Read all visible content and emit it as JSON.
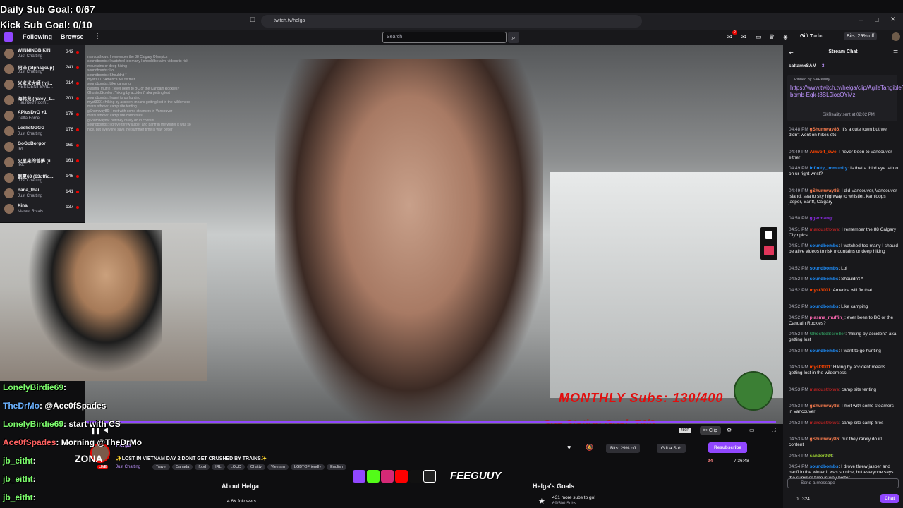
{
  "overlay_goals": {
    "daily": "Daily Sub Goal: 0/67",
    "kick": "Kick Sub Goal: 0/10"
  },
  "browser": {
    "url": "twitch.tv/helga"
  },
  "nav": {
    "following": "Following",
    "browse": "Browse",
    "search_placeholder": "Search",
    "gift_turbo": "Gift Turbo",
    "bits_offer": "Bits: 29% off",
    "notif_count": "9"
  },
  "sidebar": {
    "channels": [
      {
        "name": "WINNINGBIKINI",
        "game": "Just Chatting",
        "viewers": "243"
      },
      {
        "name": "阿泽 (alphagcup)",
        "game": "Just Chatting",
        "viewers": "241"
      },
      {
        "name": "米米米大師 (mi...",
        "game": "RESIDENT EVIL...",
        "viewers": "214"
      },
      {
        "name": "海韩兒 (haley_1...",
        "game": "Haunted Room...",
        "viewers": "201"
      },
      {
        "name": "APlusDvO +1",
        "game": "Delta Force",
        "viewers": "178"
      },
      {
        "name": "LeslieNGGG",
        "game": "Just Chatting",
        "viewers": "176"
      },
      {
        "name": "GoGoBorgor",
        "game": "IRL",
        "viewers": "169"
      },
      {
        "name": "火星來的曾夢 (iii...",
        "game": "IRL",
        "viewers": "161"
      },
      {
        "name": "劉夏63 (63offic...",
        "game": "Just Chatting",
        "viewers": "146"
      },
      {
        "name": "nana_thai",
        "game": "Just Chatting",
        "viewers": "141"
      },
      {
        "name": "Xina",
        "game": "Marvel Rivals",
        "viewers": "137"
      }
    ]
  },
  "video": {
    "monthly_text": "MONTHLY Subs: 130/400",
    "goal_text": "Spa Station Goal: 74/0",
    "progress": 0.995,
    "quality": "480P",
    "clip_label": "Clip"
  },
  "stream_overlay_chat": [
    {
      "user": "LonelyBirdie69",
      "text": ":"
    },
    {
      "user": "TheDrMo",
      "text": ": @Ace0fSpades"
    },
    {
      "user": "LonelyBirdie69",
      "text": ": start with CS"
    },
    {
      "user": "Ace0fSpades",
      "text": ": Morning @TheDrMo"
    },
    {
      "user": "jb_eitht",
      "text": ":"
    },
    {
      "user": "jb_eitht",
      "text": ":"
    },
    {
      "user": "jb_eitht",
      "text": ":"
    }
  ],
  "channel_info": {
    "streamer": "Helga",
    "title": "✨LOST IN VIETNAM DAY 2 DONT GET CRUSHED BY TRAINS✨",
    "category": "Just Chatting",
    "tags": [
      "Travel",
      "Canada",
      "food",
      "IRL",
      "LOUD",
      "Chatty",
      "Vietnam",
      "LGBTQFriendly",
      "English"
    ],
    "bits_offer": "Bits: 29% off",
    "gift_sub": "Gift a Sub",
    "resubscribe": "Resubscribe",
    "viewers": "94",
    "uptime": "7:36:48",
    "about": "About Helga",
    "followers": "4.6K followers",
    "goals_title": "Helga's Goals",
    "goals_text": "431 more subs to go!",
    "goals_progress": "69/500 Subs",
    "overlay_name": "ZONA",
    "overlay_live": "LIVE",
    "overlay_brand": "FEEGUUY"
  },
  "stream_chat": {
    "title": "Stream Chat",
    "top_user": "sattamxSAM",
    "top_count": "3",
    "pinned_by": "Pinned by SikReality",
    "pinned_link": "https://www.twitch.tv/helga/clip/AgileTangibleTurnipDxA bomb-Eqk-t8BL9iocOYMz",
    "pinned_sent": "SikReality sent at 02:02 PM",
    "messages": [
      {
        "time": "04:48 PM",
        "user": "gShumway86",
        "text": "It's a cute town but we didn't went on hikes etc",
        "color": "#ff7f50"
      },
      {
        "time": "04:49 PM",
        "user": "Airwolf_swe",
        "text": "I never been to vancouver either",
        "color": "#ff4500"
      },
      {
        "time": "04:49 PM",
        "user": "infinity_immunity",
        "text": "Is that a third eye tattoo on ur right wrist?",
        "color": "#1e90ff"
      },
      {
        "time": "04:49 PM",
        "user": "gShumway86",
        "text": "I did Vancouver, Vancouver island, sea to sky highway to whistler, kamloops jasper, Banff, Calgary",
        "color": "#ff7f50"
      },
      {
        "time": "04:50 PM",
        "user": "ggermang",
        "text": "",
        "color": "#8a2be2"
      },
      {
        "time": "04:51 PM",
        "user": "marcusthxws",
        "text": "I remember the 88 Calgary Olympics",
        "color": "#b22222"
      },
      {
        "time": "04:51 PM",
        "user": "soundbombs",
        "text": "I watched too many I should be alive videos to risk mountains or deep hiking",
        "color": "#1e90ff"
      },
      {
        "time": "04:52 PM",
        "user": "soundbombs",
        "text": "Lol",
        "color": "#1e90ff"
      },
      {
        "time": "04:52 PM",
        "user": "soundbombs",
        "text": "Shouldn't *",
        "color": "#1e90ff"
      },
      {
        "time": "04:52 PM",
        "user": "myst3001",
        "text": "America will fix that",
        "color": "#ff4500"
      },
      {
        "time": "04:52 PM",
        "user": "soundbombs",
        "text": "Like camping",
        "color": "#1e90ff"
      },
      {
        "time": "04:52 PM",
        "user": "plasma_muffin_",
        "text": "ever been to BC or the Candain Rockies?",
        "color": "#ff69b4"
      },
      {
        "time": "04:52 PM",
        "user": "GhostedScroller",
        "text": "\"hiking by accident\" aka getting lost",
        "color": "#2e8b57"
      },
      {
        "time": "04:53 PM",
        "user": "soundbombs",
        "text": "I want to go hunting",
        "color": "#1e90ff"
      },
      {
        "time": "04:53 PM",
        "user": "myst3001",
        "text": "Hiking by accident means getting lost in the wilderness",
        "color": "#ff4500"
      },
      {
        "time": "04:53 PM",
        "user": "marcusthxws",
        "text": "camp site tenting",
        "color": "#b22222"
      },
      {
        "time": "04:53 PM",
        "user": "gShumway86",
        "text": "I met with some steamers in Vancouver",
        "color": "#ff7f50"
      },
      {
        "time": "04:53 PM",
        "user": "marcusthxws",
        "text": "camp site camp fires",
        "color": "#b22222"
      },
      {
        "time": "04:53 PM",
        "user": "gShumway86",
        "text": "but they rarely do irl content",
        "color": "#ff7f50"
      },
      {
        "time": "04:54 PM",
        "user": "sander934",
        "text": "",
        "color": "#9acd32"
      },
      {
        "time": "04:54 PM",
        "user": "soundbombs",
        "text": "I drove threw jasper and banff in the winter it was so nice, but everyone says the summer time is way better",
        "color": "#1e90ff"
      }
    ],
    "send_placeholder": "Send a message",
    "points": "0",
    "bits": "324",
    "chat_button": "Chat"
  }
}
